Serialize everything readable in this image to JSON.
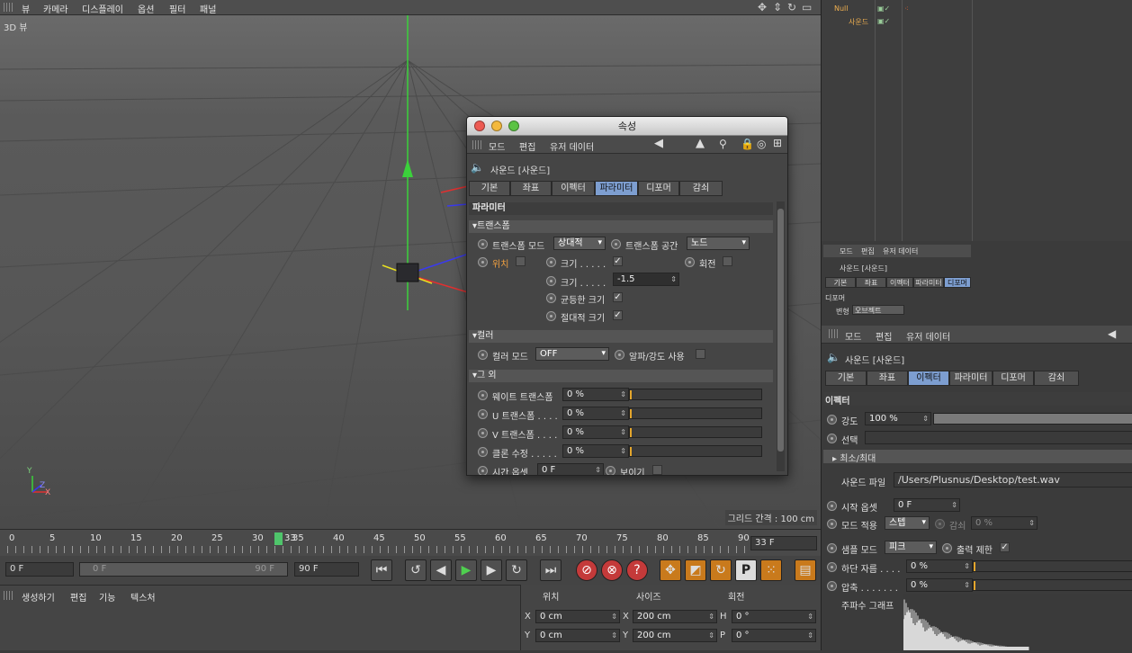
{
  "menu": {
    "items": [
      "뷰",
      "카메라",
      "디스플레이",
      "옵션",
      "필터",
      "패널"
    ]
  },
  "viewport": {
    "label": "3D 뷰",
    "grid_info": "그리드 간격 : 100 cm",
    "axis_y": "Y",
    "axis_z": "Z",
    "axis_x": "X"
  },
  "timeline": {
    "ticks": [
      "0",
      "5",
      "10",
      "15",
      "20",
      "25",
      "30",
      "35",
      "40",
      "45",
      "50",
      "55",
      "60",
      "65",
      "70",
      "75",
      "80",
      "85",
      "90"
    ],
    "current": "33",
    "current_field": "33 F",
    "start": "0 F",
    "range_start": "0 F",
    "range_end": "90 F",
    "end": "90 F"
  },
  "bottom_menu": {
    "items": [
      "생성하기",
      "편집",
      "기능",
      "텍스처"
    ]
  },
  "coords": {
    "headers": [
      "위치",
      "사이즈",
      "회전"
    ],
    "rows": [
      {
        "axis": "X",
        "pos": "0 cm",
        "size_axis": "X",
        "size": "200 cm",
        "rot_axis": "H",
        "rot": "0 °"
      },
      {
        "axis": "Y",
        "pos": "0 cm",
        "size_axis": "Y",
        "size": "200 cm",
        "rot_axis": "P",
        "rot": "0 °"
      }
    ]
  },
  "dialog": {
    "title": "속성",
    "menu": [
      "모드",
      "편집",
      "유저 데이터"
    ],
    "object": "사운드 [사운드]",
    "tabs": [
      "기본",
      "좌표",
      "이펙터",
      "파라미터",
      "디포머",
      "감쇠"
    ],
    "active_tab": "파라미터",
    "section": "파라미터",
    "transform": {
      "header": "▾트랜스폼",
      "mode_label": "트랜스폼 모드",
      "mode_value": "상대적",
      "space_label": "트랜스폼 공간",
      "space_value": "노드",
      "position": "위치",
      "scale1": "크기 . . . . .",
      "rotation": "회전",
      "scale2": "크기 . . . . .",
      "scale2_value": "-1.5",
      "uniform": "균등한 크기",
      "absolute": "절대적 크기"
    },
    "color": {
      "header": "▾컬러",
      "mode_label": "컬러 모드",
      "mode_value": "OFF",
      "alpha_label": "알파/강도 사용"
    },
    "other": {
      "header": "▾그 외",
      "rows": [
        {
          "label": "웨이트 트랜스폼",
          "value": "0 %"
        },
        {
          "label": "U 트랜스폼 . . . .",
          "value": "0 %"
        },
        {
          "label": "V 트랜스폼 . . . .",
          "value": "0 %"
        },
        {
          "label": "클론 수정 . . . . .",
          "value": "0 %"
        }
      ],
      "time_offset_label": "시간 옵셋",
      "time_offset_value": "0 F",
      "visibility_label": "보이기"
    }
  },
  "objects": {
    "items": [
      "Null",
      "사운드"
    ]
  },
  "mini_attr": {
    "menu": [
      "모드",
      "편집",
      "유저 데이터"
    ],
    "object": "사운드 [사운드]",
    "tabs": [
      "기본",
      "좌표",
      "이펙터",
      "파라미터",
      "디포머"
    ],
    "section": "디포머",
    "deform_label": "변형",
    "deform_value": "오브젝트"
  },
  "attr": {
    "menu": [
      "모드",
      "편집",
      "유저 데이터"
    ],
    "object": "사운드 [사운드]",
    "tabs": [
      "기본",
      "좌표",
      "이펙터",
      "파라미터",
      "디포머",
      "감쇠"
    ],
    "active_tab": "이펙터",
    "section": "이펙터",
    "strength_label": "강도",
    "strength_value": "100 %",
    "select_label": "선택",
    "minmax": "▸ 최소/최대",
    "file_label": "사운드 파일",
    "file_value": "/Users/Plusnus/Desktop/test.wav",
    "start_offset_label": "시작 옵셋",
    "start_offset_value": "0 F",
    "mode_apply_label": "모드 적용",
    "mode_apply_value": "스텝",
    "decay_label": "감쇠",
    "decay_value": "0 %",
    "sample_mode_label": "샘플 모드",
    "sample_mode_value": "피크",
    "clip_label": "출력 제한",
    "low_cut_label": "하단 자름 . . . .",
    "low_cut_value": "0 %",
    "compress_label": "압축 . . . . . . .",
    "compress_value": "0 %",
    "graph_label": "주파수 그래프"
  }
}
